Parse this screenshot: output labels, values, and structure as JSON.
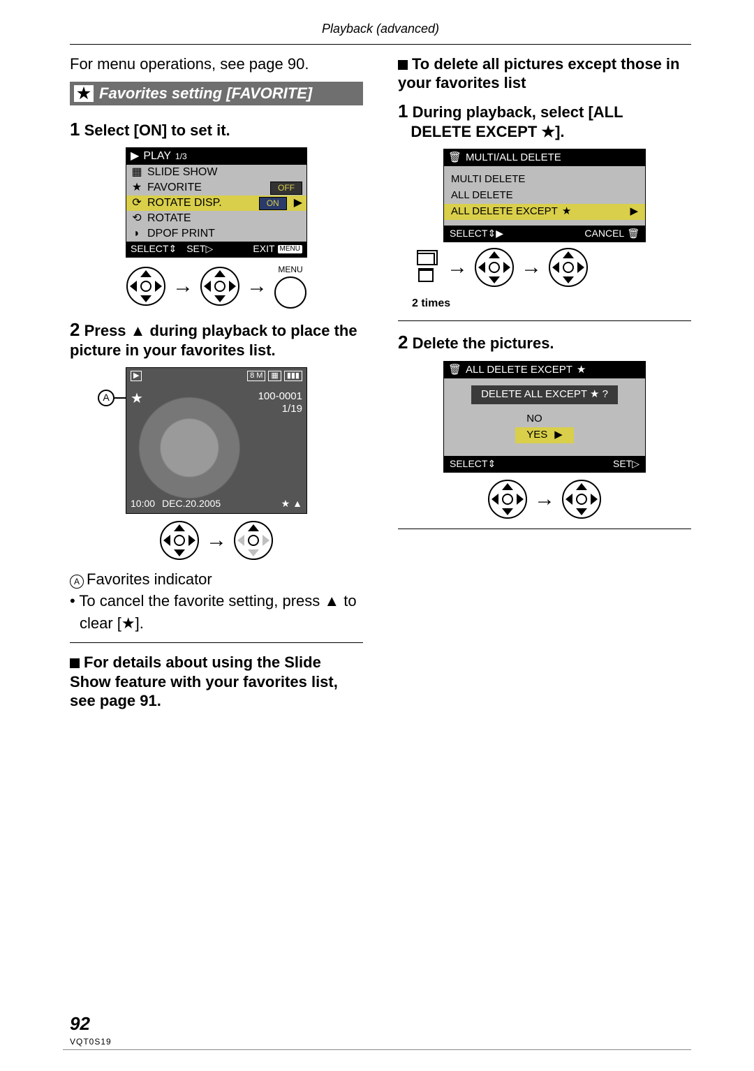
{
  "header": {
    "breadcrumb": "Playback (advanced)"
  },
  "left": {
    "intro": "For menu operations, see page 90.",
    "section_title": "Favorites setting [FAVORITE]",
    "step1": {
      "num": "1",
      "text": "Select [ON] to set it."
    },
    "lcd1": {
      "title_label": "PLAY",
      "title_page": "1/3",
      "rows": {
        "slide": "SLIDE SHOW",
        "favorite": "FAVORITE",
        "favorite_val": "OFF",
        "rotate_disp": "ROTATE DISP.",
        "rotate_disp_val": "ON",
        "rotate": "ROTATE",
        "dpof": "DPOF PRINT"
      },
      "footer": {
        "select": "SELECT",
        "set": "SET",
        "exit": "EXIT",
        "menu": "MENU"
      }
    },
    "menu_caption": "MENU",
    "step2": {
      "num": "2",
      "text": "Press ▲ during playback to place the picture in your favorites list."
    },
    "photo": {
      "size_badge": "8 M",
      "folder": "100-0001",
      "count": "1/19",
      "time": "10:00",
      "date": "DEC.20.2005"
    },
    "callout_A": "A",
    "notes": {
      "a_label": "A",
      "a_text": "Favorites indicator",
      "bullet1a": "To cancel the favorite setting, press ▲ to",
      "bullet1b": "clear [★]."
    },
    "subhead1": "For details about using the Slide Show feature with your favorites list, see page 91."
  },
  "right": {
    "subhead_top": "To delete all pictures except those in your favorites list",
    "step1": {
      "num": "1",
      "text_a": "During playback, select [ALL",
      "text_b": "DELETE EXCEPT ★]."
    },
    "lcd2": {
      "title": "MULTI/ALL DELETE",
      "opt1": "MULTI DELETE",
      "opt2": "ALL DELETE",
      "opt3": "ALL DELETE EXCEPT",
      "footer": {
        "select": "SELECT",
        "cancel": "CANCEL"
      }
    },
    "twotimes": "2 times",
    "step2": {
      "num": "2",
      "text": "Delete the pictures."
    },
    "lcd3": {
      "title": "ALL DELETE EXCEPT",
      "question": "DELETE ALL EXCEPT ★ ?",
      "no": "NO",
      "yes": "YES",
      "footer": {
        "select": "SELECT",
        "set": "SET"
      }
    }
  },
  "footer": {
    "page": "92",
    "code": "VQT0S19"
  }
}
